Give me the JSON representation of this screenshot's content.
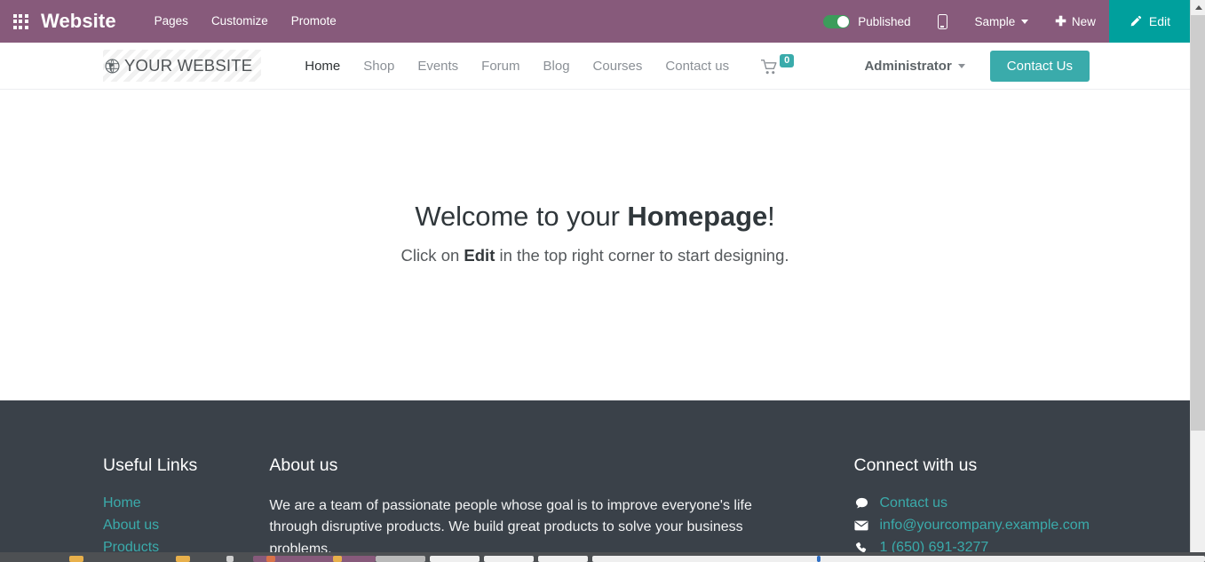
{
  "systray": {
    "apps_icon": "apps-grid-icon",
    "brand": "Website",
    "menu": [
      "Pages",
      "Customize",
      "Promote"
    ],
    "published_label": "Published",
    "published_state": "on",
    "mobile_preview_icon": "mobile-phone-icon",
    "sample_label": "Sample",
    "new_label": "New",
    "new_icon": "plus-icon",
    "edit_label": "Edit",
    "edit_icon": "pencil-icon",
    "bg_color": "#875a7b",
    "edit_color": "#00a09d",
    "toggle_color": "#3c9c5b"
  },
  "site_header": {
    "logo_icon": "globe-icon",
    "logo_text": "YOUR WEBSITE",
    "nav": [
      {
        "label": "Home",
        "active": true
      },
      {
        "label": "Shop",
        "active": false
      },
      {
        "label": "Events",
        "active": false
      },
      {
        "label": "Forum",
        "active": false
      },
      {
        "label": "Blog",
        "active": false
      },
      {
        "label": "Courses",
        "active": false
      },
      {
        "label": "Contact us",
        "active": false
      }
    ],
    "cart_icon": "shopping-cart-icon",
    "cart_count": "0",
    "user_label": "Administrator",
    "cta_label": "Contact Us",
    "accent_color": "#3aabab"
  },
  "hero": {
    "title_prefix": "Welcome to your ",
    "title_strong": "Homepage",
    "title_suffix": "!",
    "subtitle_prefix": "Click on ",
    "subtitle_strong": "Edit",
    "subtitle_suffix": " in the top right corner to start designing."
  },
  "footer": {
    "bg_color": "#3a4149",
    "useful_links": {
      "title": "Useful Links",
      "items": [
        "Home",
        "About us",
        "Products"
      ]
    },
    "about": {
      "title": "About us",
      "text": "We are a team of passionate people whose goal is to improve everyone's life through disruptive products. We build great products to solve your business problems."
    },
    "connect": {
      "title": "Connect with us",
      "items": [
        {
          "icon": "comment-icon",
          "label": "Contact us"
        },
        {
          "icon": "envelope-icon",
          "label": "info@yourcompany.example.com"
        },
        {
          "icon": "phone-icon",
          "label": "1 (650) 691-3277"
        }
      ]
    }
  },
  "scrollbar": {
    "up_icon": "chevron-up-icon",
    "down_icon": "chevron-down-icon"
  }
}
